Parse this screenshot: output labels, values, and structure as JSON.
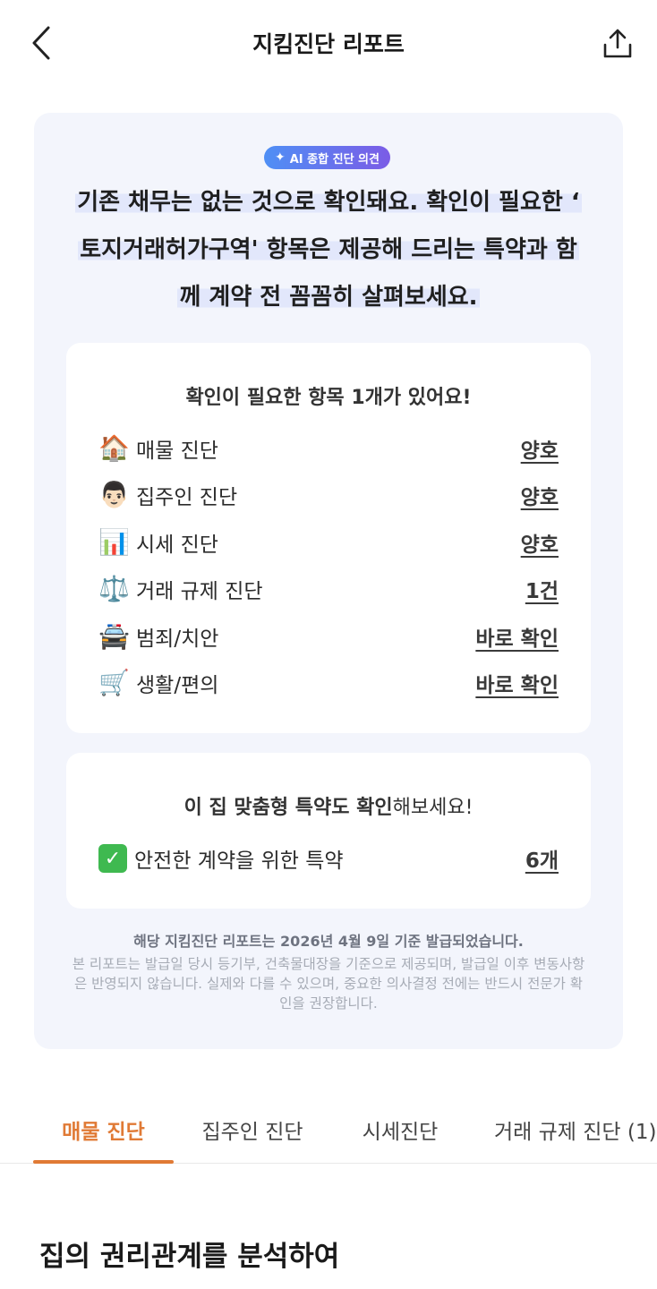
{
  "header": {
    "title": "지킴진단 리포트"
  },
  "ai_badge": {
    "label": "AI 종합 진단 의견"
  },
  "opinion": {
    "line1": "기존 채무는 없는 것으로 확인돼요. 확인이 필요한 ‘",
    "line2": "토지거래허가구역' 항목은 제공해 드리는 특약과 함",
    "line3": "께 계약 전 꼼꼼히 살펴보세요."
  },
  "check_box": {
    "heading": "확인이 필요한 항목 1개가 있어요!",
    "rows": [
      {
        "icon": "🏠",
        "label": "매물 진단",
        "value": "양호"
      },
      {
        "icon": "👨🏻",
        "label": "집주인 진단",
        "value": "양호"
      },
      {
        "icon": "📊",
        "label": "시세 진단",
        "value": "양호"
      },
      {
        "icon": "⚖️",
        "label": "거래 규제 진단",
        "value": "1건"
      },
      {
        "icon": "🚔",
        "label": "범죄/치안",
        "value": "바로 확인"
      },
      {
        "icon": "🛒",
        "label": "생활/편의",
        "value": "바로 확인"
      }
    ]
  },
  "special_box": {
    "heading_bold": "이 집 맞춤형 특약도 확인",
    "heading_light": "해보세요!",
    "row": {
      "label": "안전한 계약을 위한 특약",
      "value": "6개"
    }
  },
  "notice": {
    "strong": "해당 지킴진단 리포트는 2026년 4월 9일 기준 발급되었습니다.",
    "small": "본 리포트는 발급일 당시 등기부, 건축물대장을 기준으로 제공되며, 발급일 이후 변동사항은 반영되지 않습니다. 실제와 다를 수 있으며, 중요한 의사결정 전에는 반드시 전문가 확인을 권장합니다."
  },
  "tabs": [
    {
      "label": "매물 진단",
      "active": true
    },
    {
      "label": "집주인 진단",
      "active": false
    },
    {
      "label": "시세진단",
      "active": false
    },
    {
      "label": "거래 규제 진단 (1)",
      "active": false
    }
  ],
  "section": {
    "title": "집의 권리관계를 분석하여"
  },
  "colors": {
    "accent": "#e07a35",
    "card_bg": "#f3f5fc",
    "highlight": "#e2e7fb",
    "badge_start": "#4f8ff5",
    "badge_end": "#7b5ce6"
  }
}
